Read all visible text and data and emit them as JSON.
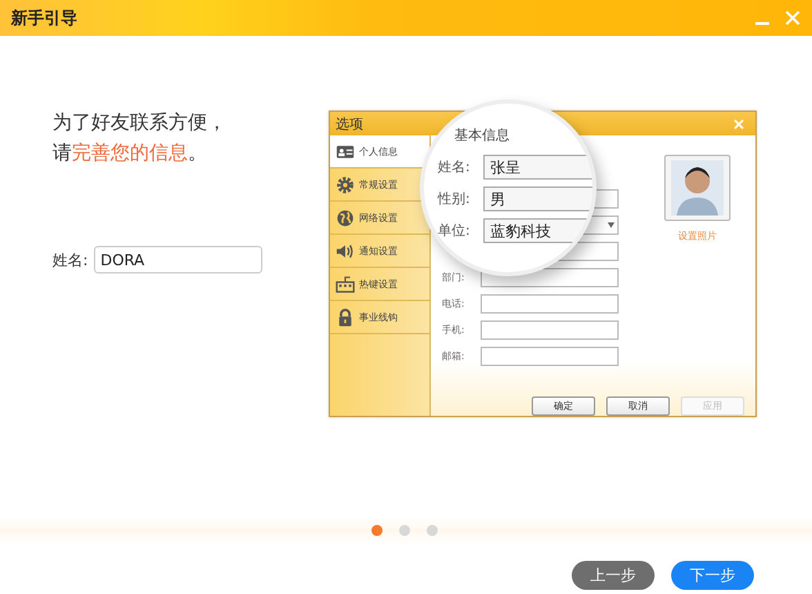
{
  "window": {
    "title": "新手引导"
  },
  "intro": {
    "line1": "为了好友联系方便，",
    "line2": "请**完善您的信息**。"
  },
  "name_field": {
    "label": "姓名:",
    "value": "DORA"
  },
  "illustration": {
    "title": "选项",
    "sidebar": [
      {
        "label": "个人信息",
        "kind": "card",
        "selected": true
      },
      {
        "label": "常规设置",
        "kind": "gear",
        "selected": false
      },
      {
        "label": "网络设置",
        "kind": "globe",
        "selected": false
      },
      {
        "label": "通知设置",
        "kind": "speaker",
        "selected": false
      },
      {
        "label": "热键设置",
        "kind": "keyboard",
        "selected": false
      },
      {
        "label": "事业线钩",
        "kind": "lock",
        "selected": false
      }
    ],
    "section": "基本信息",
    "magnified_fields": [
      {
        "label": "姓名:",
        "value": "张呈",
        "kind": "text"
      },
      {
        "label": "性别:",
        "value": "男",
        "kind": "select"
      },
      {
        "label": "单位:",
        "value": "蓝豹科技",
        "kind": "text"
      }
    ],
    "fields": [
      {
        "label": "部门:"
      },
      {
        "label": "电话:"
      },
      {
        "label": "手机:"
      },
      {
        "label": "邮箱:"
      }
    ],
    "photo_link": "设置照片",
    "buttons": [
      {
        "label": "确定",
        "disabled": false
      },
      {
        "label": "取消",
        "disabled": false
      },
      {
        "label": "应用",
        "disabled": true
      }
    ]
  },
  "pager": [
    {
      "selected": true
    },
    {
      "selected": false
    },
    {
      "selected": false
    }
  ],
  "buttons": [
    {
      "label": "上一步",
      "kind": "secondary"
    },
    {
      "label": "下一步",
      "kind": "primary"
    }
  ]
}
